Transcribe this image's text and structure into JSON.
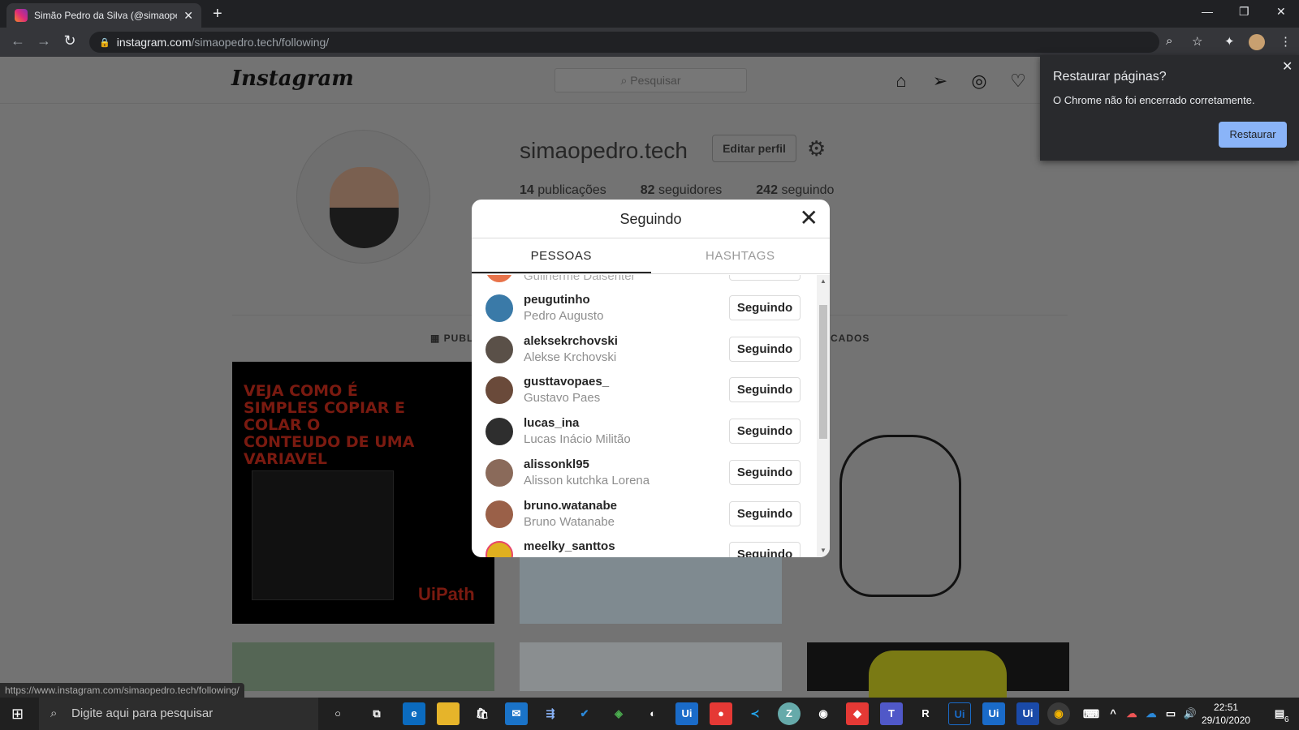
{
  "browser": {
    "tab_title": "Simão Pedro da Silva (@simaope",
    "url_host": "instagram.com",
    "url_path": "/simaopedro.tech/following/",
    "status_url": "https://www.instagram.com/simaopedro.tech/following/"
  },
  "instagram": {
    "logo": "Instagram",
    "search_placeholder": "Pesquisar",
    "username": "simaopedro.tech",
    "edit_profile": "Editar perfil",
    "stats": {
      "posts_count": "14",
      "posts_label": "publicações",
      "followers_count": "82",
      "followers_label": "seguidores",
      "following_count": "242",
      "following_label": "seguindo"
    },
    "tab_posts_partial": "PUBL",
    "tab_tagged_partial": "CADOS",
    "post1_text": "VEJA COMO É SIMPLES COPIAR E COLAR O CONTEUDO DE UMA VARIAVEL",
    "post1_brand": "UiPath"
  },
  "modal": {
    "title": "Seguindo",
    "tabs": [
      "PESSOAS",
      "HASHTAGS"
    ],
    "partial_name": "Guilherme Daisenter",
    "rows": [
      {
        "username": "peugutinho",
        "name": "Pedro Augusto",
        "button": "Seguindo"
      },
      {
        "username": "aleksekrchovski",
        "name": "Alekse Krchovski",
        "button": "Seguindo"
      },
      {
        "username": "gusttavopaes_",
        "name": "Gustavo Paes",
        "button": "Seguindo"
      },
      {
        "username": "lucas_ina",
        "name": "Lucas Inácio Militão",
        "button": "Seguindo"
      },
      {
        "username": "alissonkl95",
        "name": "Alisson kutchka Lorena",
        "button": "Seguindo"
      },
      {
        "username": "bruno.watanabe",
        "name": "Bruno Watanabe",
        "button": "Seguindo"
      },
      {
        "username": "meelky_santtos",
        "name": "",
        "button": "Seguindo"
      }
    ]
  },
  "restore_popup": {
    "title": "Restaurar páginas?",
    "message": "O Chrome não foi encerrado corretamente.",
    "button": "Restaurar"
  },
  "taskbar": {
    "search_placeholder": "Digite aqui para pesquisar",
    "time": "22:51",
    "date": "29/10/2020",
    "notif_count": "6"
  }
}
